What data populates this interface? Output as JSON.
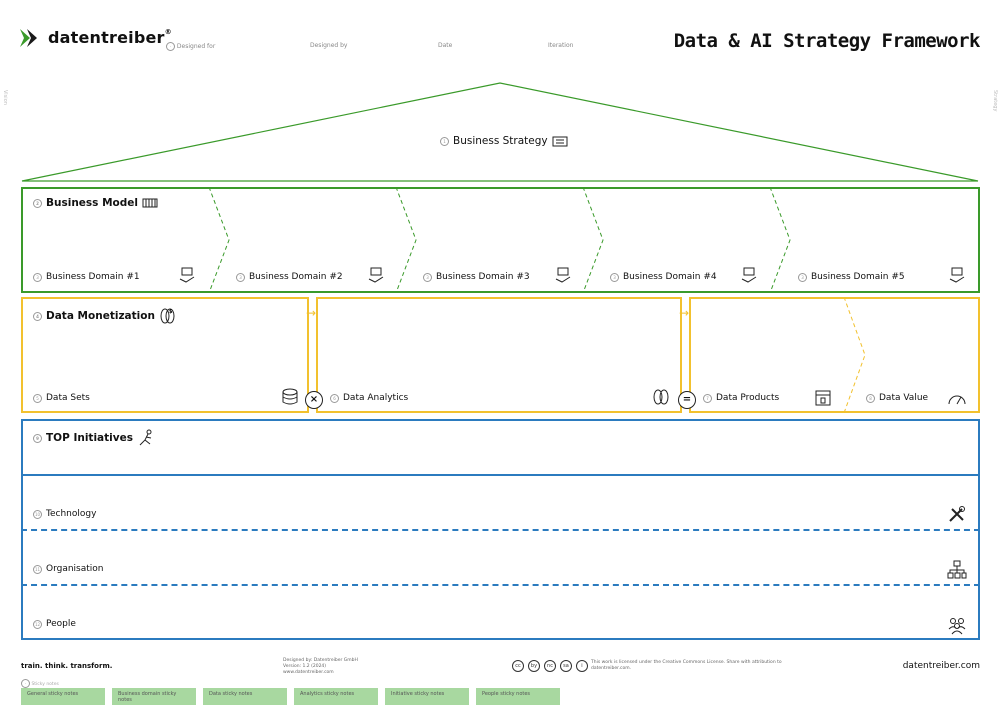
{
  "header": {
    "logo_text": "datentreiber",
    "logo_reg": "®",
    "meta": {
      "designed_for": "Designed for",
      "designed_by": "Designed by",
      "date": "Date",
      "iteration": "Iteration"
    },
    "title": "Data & AI Strategy Framework"
  },
  "side": {
    "left": "Vision",
    "right": "Strategy"
  },
  "strategy": {
    "num": "1",
    "label": "Business Strategy"
  },
  "business_model": {
    "num": "2",
    "label": "Business Model",
    "domains": [
      {
        "num": "3",
        "label": "Business Domain #1"
      },
      {
        "num": "3",
        "label": "Business Domain #2"
      },
      {
        "num": "3",
        "label": "Business Domain #3"
      },
      {
        "num": "3",
        "label": "Business Domain #4"
      },
      {
        "num": "3",
        "label": "Business Domain #5"
      }
    ]
  },
  "monetization": {
    "num": "4",
    "label": "Data Monetization",
    "arrow": "→",
    "items": [
      {
        "num": "5",
        "label": "Data Sets"
      },
      {
        "num": "6",
        "label": "Data Analytics"
      },
      {
        "num": "7",
        "label": "Data Products"
      },
      {
        "num": "8",
        "label": "Data Value"
      }
    ],
    "op_times": "×",
    "op_equals": "="
  },
  "initiatives": {
    "num": "9",
    "label": "TOP Initiatives",
    "rows": [
      {
        "num": "10",
        "label": "Technology"
      },
      {
        "num": "11",
        "label": "Organisation"
      },
      {
        "num": "12",
        "label": "People"
      }
    ]
  },
  "footer": {
    "tagline": "train. think. transform.",
    "credits": [
      "Designed by: Datentreiber GmbH",
      "Version: 1.2 (2024)",
      "www.datentreiber.com"
    ],
    "license": "This work is licensed under the Creative Commons License. Share with attribution to datentreiber.com.",
    "url": "datentreiber.com",
    "cc_icons": [
      "cc",
      "by",
      "nc",
      "sa",
      "i"
    ],
    "legend": "Sticky notes",
    "stickies": [
      "General sticky notes",
      "Business domain sticky notes",
      "Data sticky notes",
      "Analytics sticky notes",
      "Initiative sticky notes",
      "People sticky notes"
    ]
  },
  "colors": {
    "green": "#3a9a2a",
    "yellow": "#f2c12e",
    "blue": "#2b7bbf",
    "sticky": "#a8d8a0"
  }
}
